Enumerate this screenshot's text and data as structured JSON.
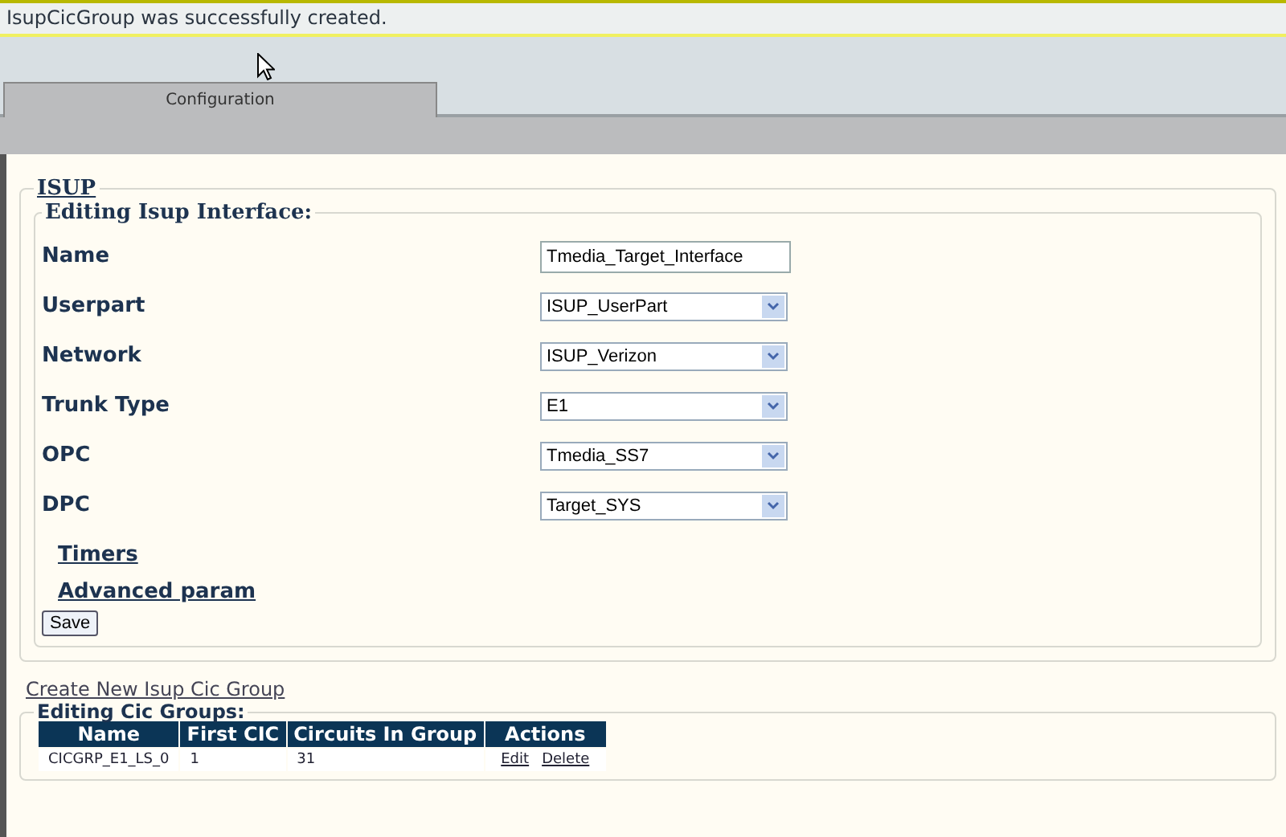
{
  "message": "IsupCicGroup was successfully created.",
  "tabs": [
    {
      "label": "Configuration",
      "selected": true
    }
  ],
  "section": {
    "title": "ISUP"
  },
  "interface": {
    "legend": "Editing Isup Interface:",
    "fields": [
      {
        "label": "Name",
        "kind": "text",
        "value": "Tmedia_Target_Interface"
      },
      {
        "label": "Userpart",
        "kind": "select",
        "value": "ISUP_UserPart"
      },
      {
        "label": "Network",
        "kind": "select",
        "value": "ISUP_Verizon"
      },
      {
        "label": "Trunk Type",
        "kind": "select",
        "value": "E1"
      },
      {
        "label": "OPC",
        "kind": "select",
        "value": "Tmedia_SS7"
      },
      {
        "label": "DPC",
        "kind": "select",
        "value": "Target_SYS"
      }
    ],
    "links": [
      "Timers",
      "Advanced param"
    ],
    "save": "Save"
  },
  "create_link": "Create New Isup Cic Group",
  "cic_groups": {
    "legend": "Editing Cic Groups:",
    "columns": [
      "Name",
      "First CIC",
      "Circuits In Group",
      "Actions"
    ],
    "rows": [
      {
        "name": "CICGRP_E1_LS_0",
        "first_cic": "1",
        "circuits": "31",
        "actions": [
          "Edit",
          "Delete"
        ]
      }
    ]
  }
}
